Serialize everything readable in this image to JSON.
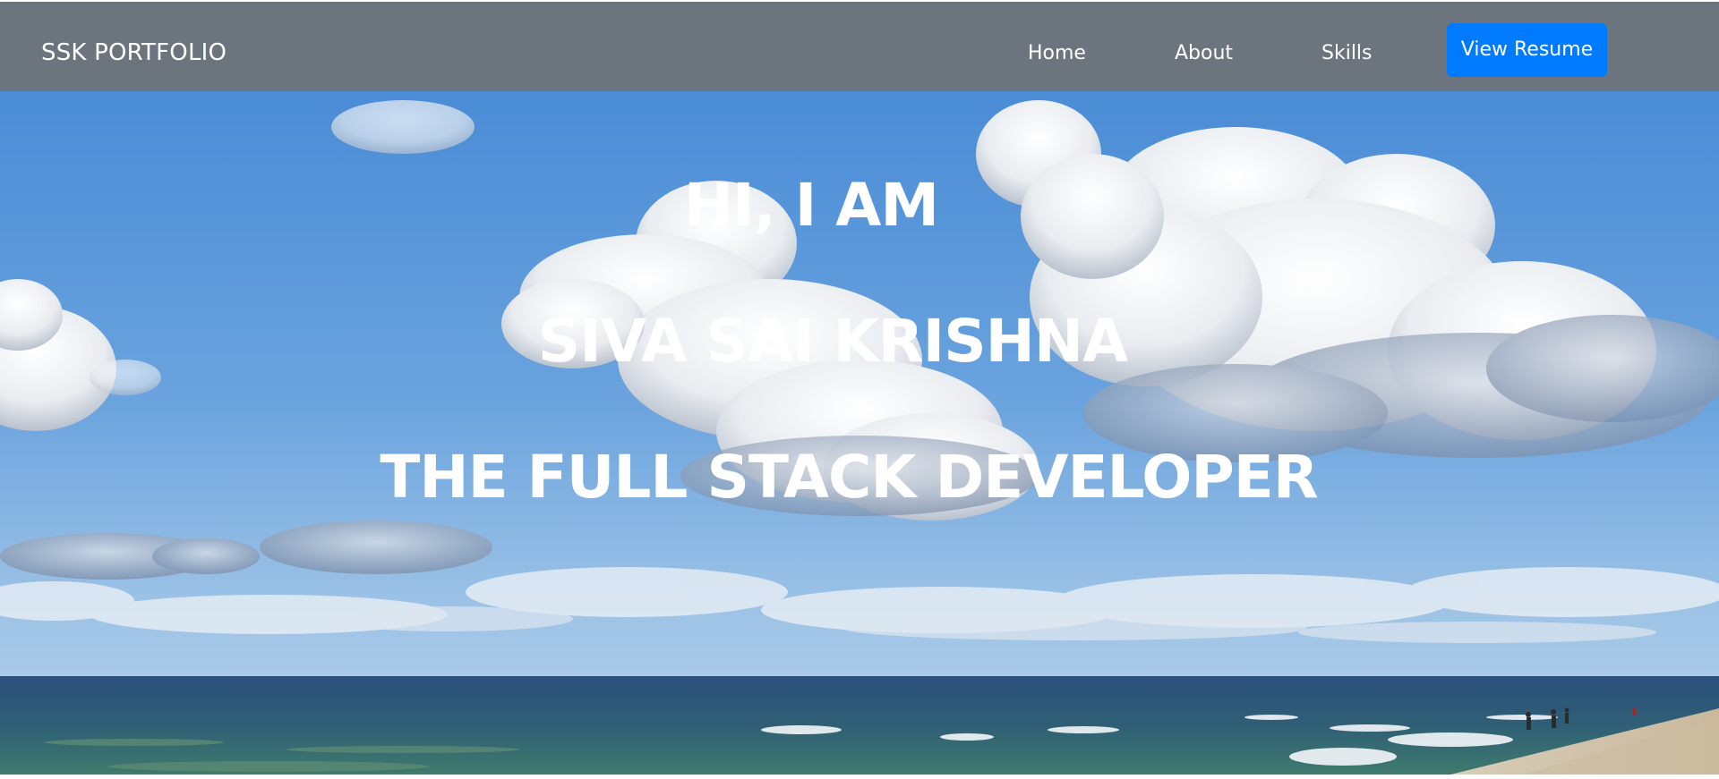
{
  "navbar": {
    "brand": "SSK PORTFOLIO",
    "links": [
      {
        "label": "Home"
      },
      {
        "label": "About"
      },
      {
        "label": "Skills"
      }
    ],
    "resume_button": "View Resume",
    "background_color": "#6c757d",
    "button_color": "#007bff"
  },
  "hero": {
    "lines": [
      "HI, I AM",
      "SIVA SAI KRISHNA",
      "THE FULL STACK DEVELOPER"
    ],
    "background": "sky-with-clouds-over-beach"
  }
}
